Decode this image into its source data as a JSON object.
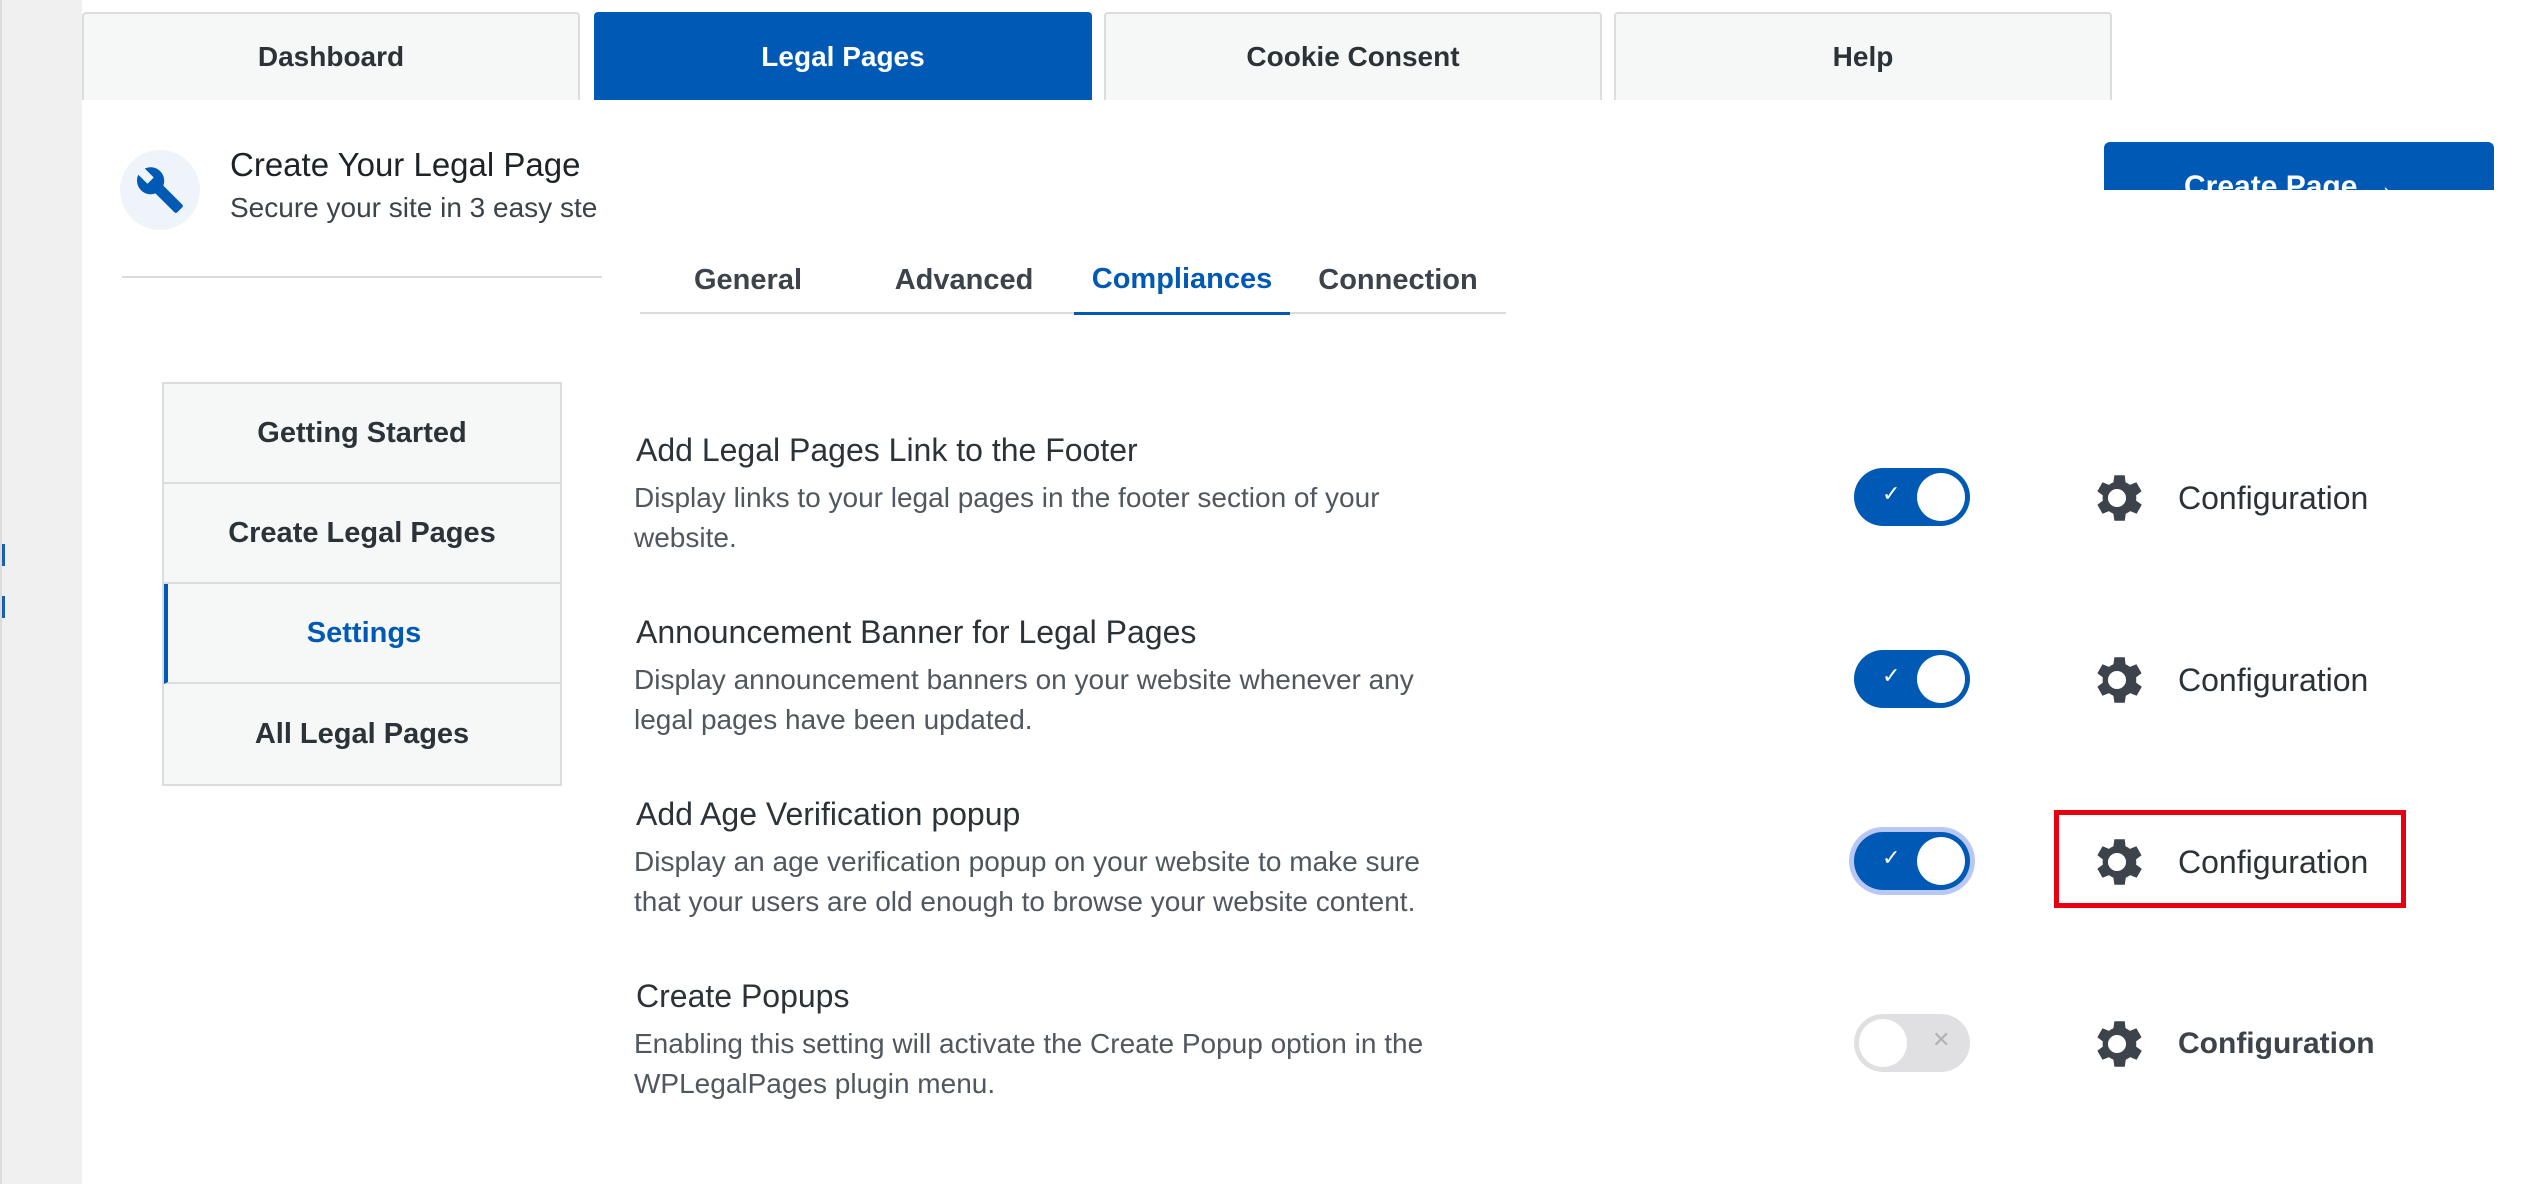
{
  "top_tabs": [
    {
      "label": "Dashboard",
      "active": false
    },
    {
      "label": "Legal Pages",
      "active": true
    },
    {
      "label": "Cookie Consent",
      "active": false
    },
    {
      "label": "Help",
      "active": false
    }
  ],
  "header": {
    "icon": "wrench-icon",
    "title": "Create Your Legal Page",
    "subtitle": "Secure your site in 3 easy ste",
    "create_button": "Create Page →"
  },
  "sub_tabs": [
    {
      "label": "General",
      "active": false
    },
    {
      "label": "Advanced",
      "active": false
    },
    {
      "label": "Compliances",
      "active": true
    },
    {
      "label": "Connection",
      "active": false
    }
  ],
  "side_menu": [
    {
      "label": "Getting Started",
      "active": false
    },
    {
      "label": "Create Legal Pages",
      "active": false
    },
    {
      "label": "Settings",
      "active": true
    },
    {
      "label": "All Legal Pages",
      "active": false
    }
  ],
  "settings": [
    {
      "title": "Add Legal Pages Link to the Footer",
      "description": "Display links to your legal pages in the footer section of your website.",
      "enabled": true,
      "config_label": "Configuration"
    },
    {
      "title": "Announcement Banner for Legal Pages",
      "description": "Display announcement banners on your website whenever any legal pages have been updated.",
      "enabled": true,
      "config_label": "Configuration"
    },
    {
      "title": "Add Age Verification popup",
      "description": "Display an age verification popup on your website to make sure that your users are old enough to browse your website content.",
      "enabled": true,
      "config_label": "Configuration"
    },
    {
      "title": "Create Popups",
      "description": "Enabling this setting will activate the Create Popup option in the WPLegalPages plugin menu.",
      "enabled": false,
      "config_label": "Configuration"
    }
  ],
  "toggle_marks": {
    "on": "✓",
    "off": "✕"
  },
  "colors": {
    "accent": "#005ab5",
    "highlight": "#e60012",
    "toggle_off": "#e0e0e3"
  }
}
